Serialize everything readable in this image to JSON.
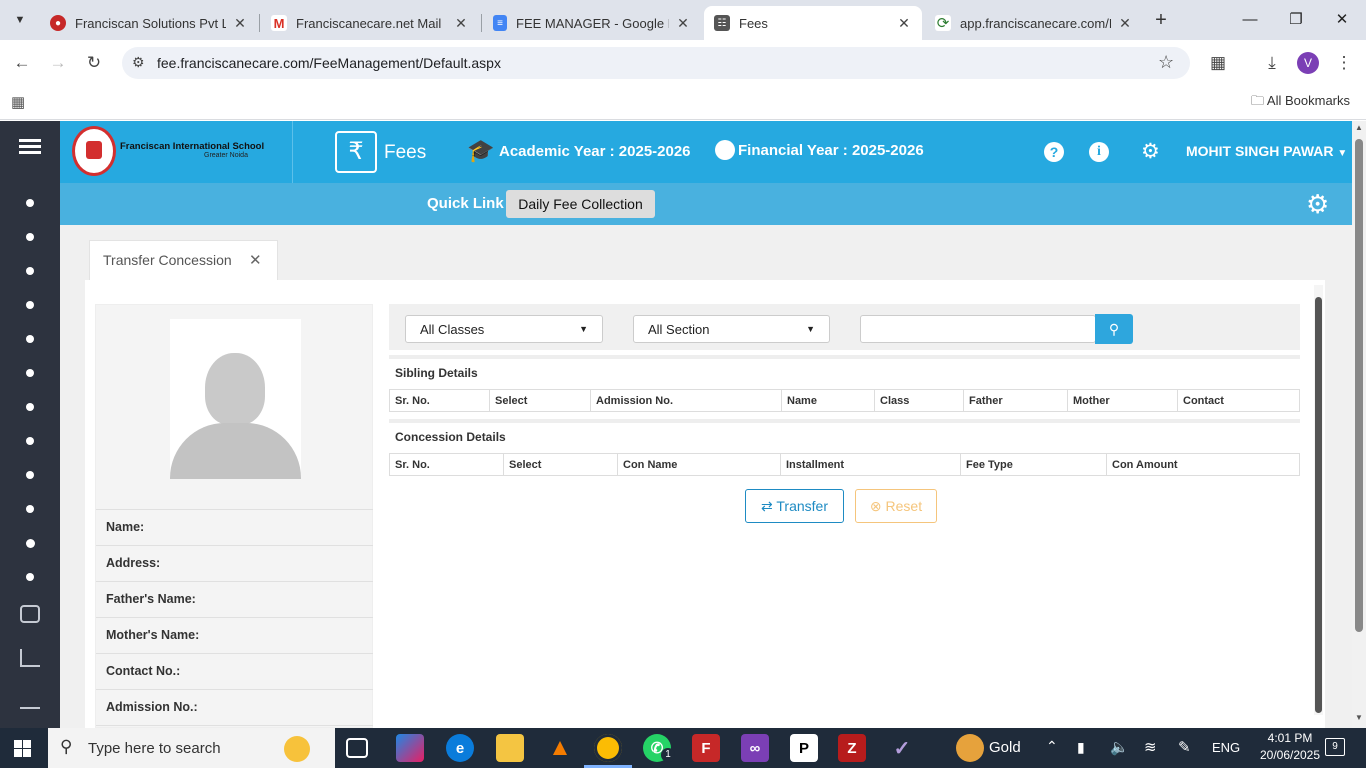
{
  "browser": {
    "tabs": [
      {
        "title": "Franciscan Solutions Pvt Ltd.",
        "icon": "franciscan-logo-icon"
      },
      {
        "title": "Franciscanecare.net Mail",
        "icon": "gmail-icon"
      },
      {
        "title": "FEE MANAGER - Google Docs",
        "icon": "google-docs-icon"
      },
      {
        "title": "Fees",
        "icon": "fees-icon"
      },
      {
        "title": "app.franciscanecare.com/Po",
        "icon": "app-icon"
      }
    ],
    "url": "fee.franciscanecare.com/FeeManagement/Default.aspx",
    "profile_initial": "V",
    "bookmarks_label": "All Bookmarks"
  },
  "header": {
    "school_name": "Franciscan International School",
    "school_sub": "Greater Noida",
    "module": "Fees",
    "academic_year": "Academic Year : 2025-2026",
    "financial_year": "Financial Year : 2025-2026",
    "user": "MOHIT SINGH PAWAR"
  },
  "quicklink": {
    "label": "Quick Link",
    "button": "Daily Fee Collection"
  },
  "page_tab": {
    "label": "Transfer Concession"
  },
  "student": {
    "labels": [
      "Name:",
      "Address:",
      "Father's Name:",
      "Mother's Name:",
      "Contact No.:",
      "Admission No.:"
    ]
  },
  "filters": {
    "class": "All Classes",
    "section": "All Section",
    "search_value": ""
  },
  "sibling": {
    "title": "Sibling Details",
    "columns": [
      "Sr. No.",
      "Select",
      "Admission No.",
      "Name",
      "Class",
      "Father",
      "Mother",
      "Contact"
    ]
  },
  "concession": {
    "title": "Concession Details",
    "columns": [
      "Sr. No.",
      "Select",
      "Con Name",
      "Installment",
      "Fee Type",
      "Con Amount"
    ]
  },
  "actions": {
    "transfer": "Transfer",
    "reset": "Reset"
  },
  "taskbar": {
    "search_placeholder": "Type here to search",
    "weather": "Gold",
    "lang": "ENG",
    "time": "4:01 PM",
    "date": "20/06/2025",
    "notif_count": "9",
    "whatsapp_badge": "1"
  },
  "colors": {
    "header": "#26a9e0",
    "sidebar": "#2d333f",
    "transfer": "#1e8bc3",
    "reset": "#f0ad4e"
  }
}
